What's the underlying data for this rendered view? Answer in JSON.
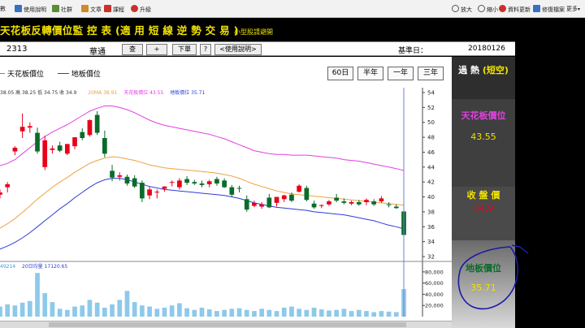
{
  "toolbar": {
    "items": [
      {
        "label": "使用說明",
        "color": "#3a6fc4"
      },
      {
        "label": "社群",
        "color": "#5b8c3a"
      },
      {
        "label": "文章",
        "color": "#d08a2a"
      },
      {
        "label": "課程",
        "color": "#c8322b"
      },
      {
        "label": "升級",
        "color": "#c8322b"
      }
    ],
    "truncated_left": "數",
    "right_items": [
      {
        "label": "放大",
        "color": "#555555"
      },
      {
        "label": "縮小",
        "color": "#555555"
      },
      {
        "label": "資料更新",
        "color": "#c8322b"
      },
      {
        "label": "修復檔案",
        "color": "#3a6fc4"
      },
      {
        "label": "更多",
        "color": "#555555"
      }
    ]
  },
  "title": {
    "main": "天花板反轉價位監 控 表 (適 用 短 線 逆 勢 交 易 )",
    "sub": "小型股請避開"
  },
  "controls": {
    "code": "2313",
    "name": "華通",
    "buttons": [
      "查",
      "+",
      "下單",
      "?",
      "<使用說明>"
    ],
    "ref_label": "基準日：",
    "ref_date": "20180126"
  },
  "legend": {
    "ceiling": "天花板價位",
    "floor": "地板價位"
  },
  "periods": [
    "60日",
    "半年",
    "一年",
    "三年"
  ],
  "info_line": {
    "ohlc": "38.05 高 38.25 低 34.75 收 34.9",
    "ma": "20MA 38.91",
    "ceil": "天花板價位 43.55",
    "floor": "地板價位 35.71"
  },
  "vol_info": {
    "vol": "49214",
    "avg": "20日均量 17120.65"
  },
  "panel": {
    "heat_title": "過 熱",
    "heat_sub": "(短空)",
    "ceiling_title": "天花板價位",
    "ceiling_value": "43.55",
    "close_title": "收 盤 價",
    "close_value": "34.9",
    "floor_title": "地板價位",
    "floor_value": "35.71"
  },
  "colors": {
    "up": "#e8001c",
    "down": "#0b6b2a",
    "ceiling": "#e040e0",
    "floor": "#2d3cd8",
    "ma": "#f0a040",
    "volume": "#8ec9ea",
    "title": "#f0e100",
    "annotation": "#1a1aa8"
  },
  "chart_data": {
    "type": "candlestick",
    "price_axis": {
      "min": 32,
      "max": 54,
      "ticks": [
        32,
        34,
        36,
        38,
        40,
        42,
        44,
        46,
        48,
        50,
        52,
        54
      ]
    },
    "volume_axis": {
      "min": 0,
      "max": 90000,
      "ticks": [
        "20,000",
        "40,000",
        "60,000",
        "80,000"
      ],
      "tick_values": [
        20000,
        40000,
        60000,
        80000
      ]
    },
    "candles": [
      {
        "o": 40.3,
        "h": 41.0,
        "l": 39.8,
        "c": 40.6
      },
      {
        "o": 41.3,
        "h": 42.0,
        "l": 40.6,
        "c": 41.7
      },
      {
        "o": 46.1,
        "h": 46.8,
        "l": 45.6,
        "c": 46.6
      },
      {
        "o": 48.8,
        "h": 51.2,
        "l": 47.9,
        "c": 49.4
      },
      {
        "o": 49.3,
        "h": 50.0,
        "l": 48.6,
        "c": 49.5
      },
      {
        "o": 48.6,
        "h": 49.3,
        "l": 45.8,
        "c": 46.1
      },
      {
        "o": 44.0,
        "h": 48.2,
        "l": 43.6,
        "c": 47.6
      },
      {
        "o": 46.3,
        "h": 46.9,
        "l": 45.8,
        "c": 46.5
      },
      {
        "o": 46.9,
        "h": 47.4,
        "l": 46.0,
        "c": 46.2
      },
      {
        "o": 45.8,
        "h": 47.1,
        "l": 45.6,
        "c": 47.1
      },
      {
        "o": 46.8,
        "h": 48.0,
        "l": 46.4,
        "c": 48.0
      },
      {
        "o": 48.7,
        "h": 49.2,
        "l": 47.6,
        "c": 47.9
      },
      {
        "o": 48.3,
        "h": 50.4,
        "l": 48.1,
        "c": 50.3
      },
      {
        "o": 51.0,
        "h": 51.5,
        "l": 48.3,
        "c": 48.6
      },
      {
        "o": 47.9,
        "h": 48.9,
        "l": 45.3,
        "c": 45.8
      },
      {
        "o": 43.5,
        "h": 44.3,
        "l": 42.1,
        "c": 42.6
      },
      {
        "o": 42.7,
        "h": 43.3,
        "l": 42.2,
        "c": 42.9
      },
      {
        "o": 42.7,
        "h": 43.0,
        "l": 41.5,
        "c": 41.8
      },
      {
        "o": 42.5,
        "h": 42.9,
        "l": 41.2,
        "c": 41.4
      },
      {
        "o": 41.9,
        "h": 42.2,
        "l": 39.3,
        "c": 39.8
      },
      {
        "o": 40.2,
        "h": 41.4,
        "l": 39.7,
        "c": 41.0
      },
      {
        "o": 40.7,
        "h": 41.0,
        "l": 39.8,
        "c": 40.7
      },
      {
        "o": 41.1,
        "h": 41.4,
        "l": 40.7,
        "c": 41.4
      },
      {
        "o": 42.0,
        "h": 42.2,
        "l": 41.4,
        "c": 42.0
      },
      {
        "o": 41.3,
        "h": 42.5,
        "l": 41.0,
        "c": 42.2
      },
      {
        "o": 42.4,
        "h": 42.8,
        "l": 41.6,
        "c": 41.9
      },
      {
        "o": 42.0,
        "h": 42.3,
        "l": 41.6,
        "c": 41.8
      },
      {
        "o": 41.8,
        "h": 42.2,
        "l": 41.3,
        "c": 41.6
      },
      {
        "o": 41.7,
        "h": 42.3,
        "l": 41.3,
        "c": 42.1
      },
      {
        "o": 42.4,
        "h": 42.7,
        "l": 41.5,
        "c": 41.8
      },
      {
        "o": 42.2,
        "h": 42.5,
        "l": 41.2,
        "c": 41.3
      },
      {
        "o": 41.3,
        "h": 41.6,
        "l": 40.0,
        "c": 40.3
      },
      {
        "o": 41.2,
        "h": 41.5,
        "l": 40.6,
        "c": 41.1
      },
      {
        "o": 39.7,
        "h": 40.2,
        "l": 38.0,
        "c": 38.3
      },
      {
        "o": 38.8,
        "h": 39.5,
        "l": 38.6,
        "c": 39.2
      },
      {
        "o": 38.7,
        "h": 39.3,
        "l": 38.4,
        "c": 39.0
      },
      {
        "o": 39.9,
        "h": 40.4,
        "l": 38.5,
        "c": 38.6
      },
      {
        "o": 39.2,
        "h": 40.0,
        "l": 38.7,
        "c": 40.0
      },
      {
        "o": 39.7,
        "h": 40.3,
        "l": 39.3,
        "c": 40.2
      },
      {
        "o": 40.3,
        "h": 40.6,
        "l": 39.3,
        "c": 39.5
      },
      {
        "o": 40.7,
        "h": 41.7,
        "l": 40.6,
        "c": 41.5
      },
      {
        "o": 41.2,
        "h": 41.5,
        "l": 39.4,
        "c": 39.6
      },
      {
        "o": 39.1,
        "h": 39.5,
        "l": 38.4,
        "c": 38.6
      },
      {
        "o": 38.8,
        "h": 39.0,
        "l": 38.5,
        "c": 38.9
      },
      {
        "o": 39.0,
        "h": 39.6,
        "l": 38.8,
        "c": 39.4
      },
      {
        "o": 39.9,
        "h": 40.4,
        "l": 39.3,
        "c": 39.5
      },
      {
        "o": 39.4,
        "h": 39.8,
        "l": 39.0,
        "c": 39.2
      },
      {
        "o": 39.1,
        "h": 39.5,
        "l": 38.9,
        "c": 39.3
      },
      {
        "o": 39.3,
        "h": 39.6,
        "l": 38.8,
        "c": 39.0
      },
      {
        "o": 39.3,
        "h": 39.8,
        "l": 38.9,
        "c": 39.6
      },
      {
        "o": 39.4,
        "h": 39.7,
        "l": 38.8,
        "c": 39.0
      },
      {
        "o": 39.4,
        "h": 40.1,
        "l": 39.2,
        "c": 39.8
      },
      {
        "o": 39.0,
        "h": 39.3,
        "l": 38.6,
        "c": 38.9
      },
      {
        "o": 38.7,
        "h": 39.0,
        "l": 38.4,
        "c": 38.5
      },
      {
        "o": 38.05,
        "h": 38.25,
        "l": 34.75,
        "c": 34.9
      }
    ],
    "ceiling_line": [
      44.2,
      44.5,
      45.0,
      45.8,
      46.6,
      47.4,
      48.1,
      48.7,
      49.2,
      49.7,
      50.3,
      50.9,
      51.5,
      51.9,
      52.2,
      52.2,
      52.0,
      51.7,
      51.3,
      50.8,
      50.3,
      49.9,
      49.6,
      49.4,
      49.2,
      49.0,
      48.8,
      48.6,
      48.4,
      48.1,
      47.8,
      47.4,
      47.0,
      46.6,
      46.2,
      46.0,
      45.8,
      45.7,
      45.7,
      45.6,
      45.6,
      45.6,
      45.5,
      45.4,
      45.3,
      45.2,
      45.0,
      44.9,
      44.8,
      44.6,
      44.4,
      44.2,
      44.0,
      43.8,
      43.55
    ],
    "floor_line": [
      33.0,
      33.4,
      33.9,
      34.5,
      35.2,
      36.0,
      36.8,
      37.6,
      38.4,
      39.1,
      39.9,
      40.6,
      41.3,
      41.9,
      42.3,
      42.5,
      42.5,
      42.3,
      42.0,
      41.7,
      41.4,
      41.2,
      41.0,
      40.9,
      40.8,
      40.7,
      40.6,
      40.5,
      40.4,
      40.3,
      40.2,
      40.0,
      39.8,
      39.5,
      39.2,
      39.0,
      38.8,
      38.6,
      38.5,
      38.4,
      38.3,
      38.2,
      38.0,
      37.9,
      37.8,
      37.7,
      37.6,
      37.4,
      37.2,
      37.0,
      36.8,
      36.5,
      36.2,
      36.0,
      35.71
    ],
    "ma_line": [
      35.8,
      36.4,
      37.1,
      37.9,
      38.8,
      39.7,
      40.5,
      41.3,
      42.0,
      42.6,
      43.3,
      43.9,
      44.5,
      44.9,
      45.2,
      45.4,
      45.3,
      45.1,
      44.9,
      44.6,
      44.3,
      44.1,
      43.9,
      43.8,
      43.7,
      43.6,
      43.5,
      43.4,
      43.3,
      43.2,
      43.0,
      42.8,
      42.5,
      42.1,
      41.7,
      41.4,
      41.1,
      40.8,
      40.6,
      40.4,
      40.3,
      40.2,
      40.1,
      40.0,
      39.9,
      39.8,
      39.7,
      39.6,
      39.5,
      39.4,
      39.3,
      39.2,
      39.1,
      39.0,
      38.91
    ],
    "volume": [
      18000,
      22000,
      20000,
      25000,
      28000,
      78000,
      42000,
      26000,
      14000,
      12000,
      18000,
      20000,
      30000,
      25000,
      16000,
      22000,
      30000,
      46000,
      26000,
      20000,
      18000,
      14000,
      16000,
      20000,
      24000,
      15000,
      12000,
      16000,
      13000,
      10000,
      12000,
      14000,
      15000,
      12000,
      10000,
      14000,
      12000,
      10000,
      16000,
      18000,
      14000,
      12000,
      16000,
      13000,
      11000,
      12000,
      14000,
      10000,
      12000,
      10000,
      8000,
      10000,
      9000,
      8000,
      49214
    ]
  }
}
